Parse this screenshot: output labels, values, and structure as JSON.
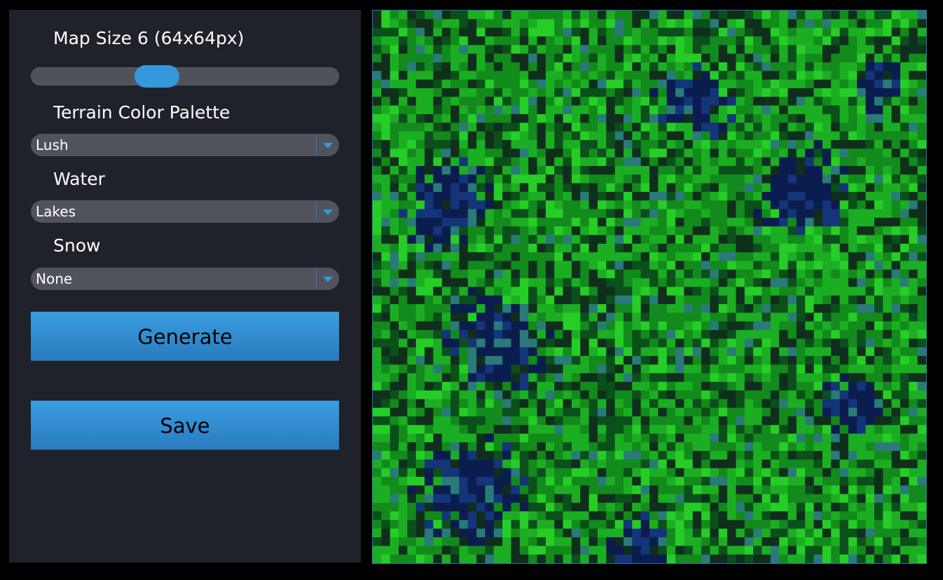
{
  "controls": {
    "map_size_label": "Map Size 6 (64x64px)",
    "map_size_slider_fraction": 0.41,
    "palette_label": "Terrain Color Palette",
    "palette_value": "Lush",
    "water_label": "Water",
    "water_value": "Lakes",
    "snow_label": "Snow",
    "snow_value": "None",
    "generate_label": "Generate",
    "save_label": "Save"
  },
  "map": {
    "grid_cells": 64,
    "palette_colors": [
      "#0f2f1c",
      "#0b4f1b",
      "#138a1c",
      "#1cae22",
      "#27cd27",
      "#0b1d4e",
      "#14357a",
      "#2a7a7a"
    ],
    "accent_color": "#3498db"
  }
}
